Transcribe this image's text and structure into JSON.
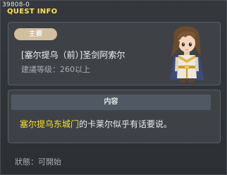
{
  "window": {
    "quest_id": "39808-0",
    "title": "QUEST INFO"
  },
  "summary": {
    "tag": "主要",
    "quest_name": "[塞尔提乌（前）]圣剑阿索尔",
    "required_level": "建議等级：260以上"
  },
  "npc": {
    "portrait_icon": "npc-portrait-icon"
  },
  "content": {
    "header": "内容",
    "highlight": "塞尔提乌东城门",
    "text_rest": "的卡莱尔似乎有话要说。"
  },
  "status": {
    "label": "狀態：可開始"
  },
  "colors": {
    "title": "#ffe05a",
    "highlight": "#f5e02c",
    "tag": "#d2bf9d"
  }
}
